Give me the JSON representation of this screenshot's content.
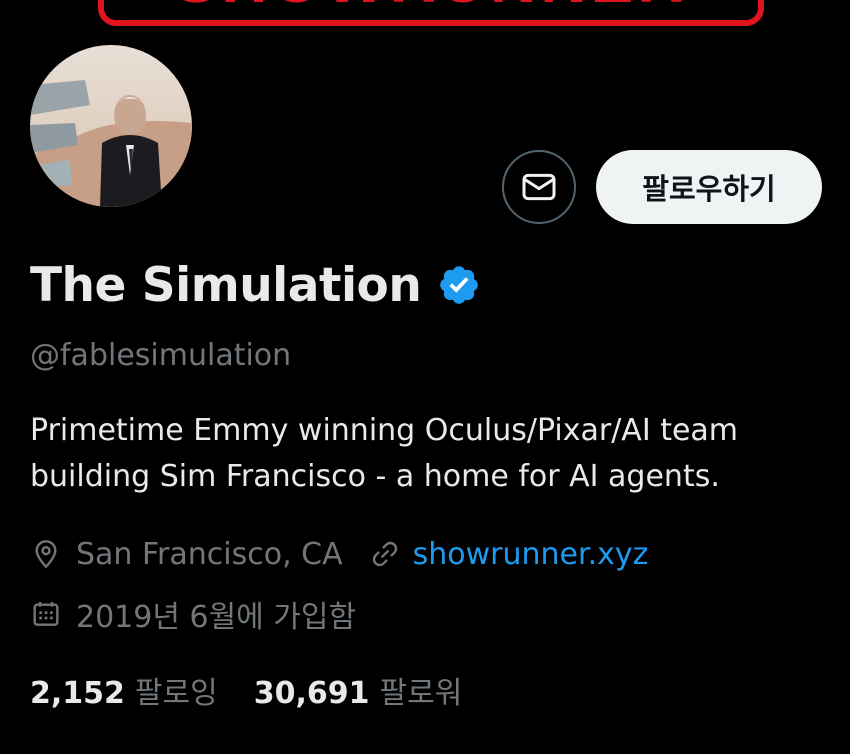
{
  "banner": {
    "text": "SHOWRUNNER",
    "border_color": "#e0141e"
  },
  "profile": {
    "avatar_icon": "avatar",
    "display_name": "The Simulation",
    "verified_icon": "verified-badge-icon",
    "verified_color": "#1d9bf0",
    "handle": "@fablesimulation",
    "bio_lines": [
      "Primetime Emmy winning Oculus/Pixar/AI team",
      "building Sim Francisco - a home for AI agents."
    ],
    "location_icon": "location-pin-icon",
    "location": "San Francisco, CA",
    "link_icon": "link-icon",
    "link": "showrunner.xyz",
    "link_color": "#1d9bf0",
    "joined_icon": "calendar-icon",
    "joined": "2019년 6월에 가입함"
  },
  "actions": {
    "message_icon": "envelope-icon",
    "follow_label": "팔로우하기"
  },
  "stats": {
    "following_count": "2,152",
    "following_label": "팔로잉",
    "followers_count": "30,691",
    "followers_label": "팔로워"
  }
}
